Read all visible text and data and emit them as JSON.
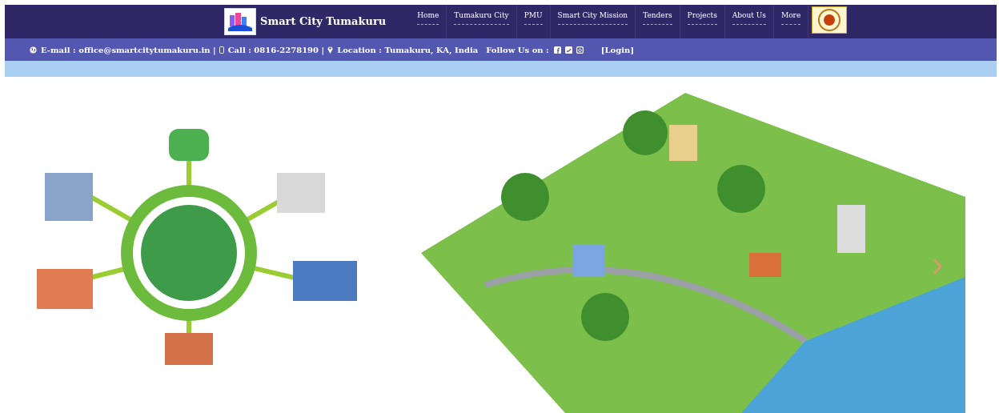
{
  "header": {
    "site_title": "Smart City Tumakuru",
    "nav": [
      {
        "label": "Home"
      },
      {
        "label": "Tumakuru City"
      },
      {
        "label": "PMU"
      },
      {
        "label": "Smart City Mission"
      },
      {
        "label": "Tenders"
      },
      {
        "label": "Projects"
      },
      {
        "label": "About Us"
      },
      {
        "label": "More"
      }
    ]
  },
  "contact_bar": {
    "email": "E-mail : office@smartcitytumakuru.in |",
    "call": "Call : 0816-2278190 |",
    "location": "Location : Tumakuru, KA, India",
    "follow": "Follow Us on :",
    "login": "[Login]"
  }
}
